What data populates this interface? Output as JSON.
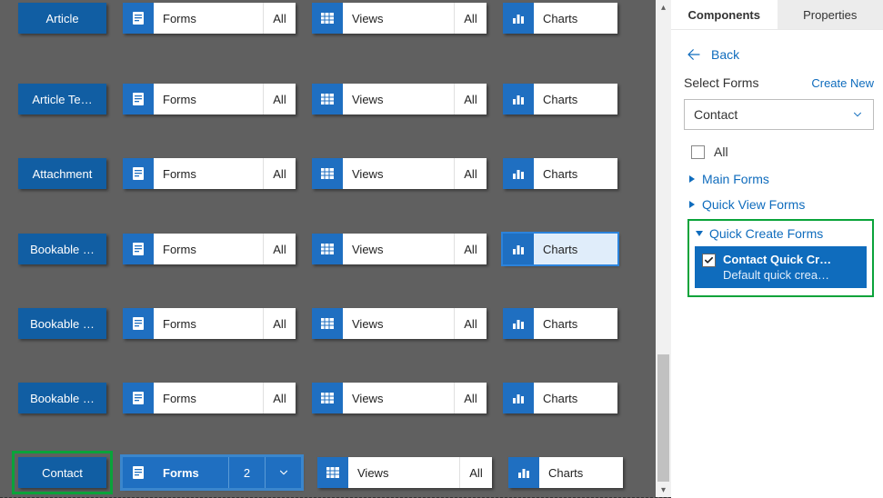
{
  "canvas": {
    "rows": [
      {
        "entity": "Article",
        "selected": false,
        "forms": {
          "label": "Forms",
          "tag": "All",
          "selected": false
        },
        "views": {
          "label": "Views",
          "tag": "All"
        },
        "charts": {
          "label": "Charts",
          "highlight": false
        }
      },
      {
        "entity": "Article Te…",
        "selected": false,
        "forms": {
          "label": "Forms",
          "tag": "All",
          "selected": false
        },
        "views": {
          "label": "Views",
          "tag": "All"
        },
        "charts": {
          "label": "Charts",
          "highlight": false
        }
      },
      {
        "entity": "Attachment",
        "selected": false,
        "forms": {
          "label": "Forms",
          "tag": "All",
          "selected": false
        },
        "views": {
          "label": "Views",
          "tag": "All"
        },
        "charts": {
          "label": "Charts",
          "highlight": false
        }
      },
      {
        "entity": "Bookable …",
        "selected": false,
        "forms": {
          "label": "Forms",
          "tag": "All",
          "selected": false
        },
        "views": {
          "label": "Views",
          "tag": "All"
        },
        "charts": {
          "label": "Charts",
          "highlight": true
        }
      },
      {
        "entity": "Bookable …",
        "selected": false,
        "forms": {
          "label": "Forms",
          "tag": "All",
          "selected": false
        },
        "views": {
          "label": "Views",
          "tag": "All"
        },
        "charts": {
          "label": "Charts",
          "highlight": false
        }
      },
      {
        "entity": "Bookable …",
        "selected": false,
        "forms": {
          "label": "Forms",
          "tag": "All",
          "selected": false
        },
        "views": {
          "label": "Views",
          "tag": "All"
        },
        "charts": {
          "label": "Charts",
          "highlight": false
        }
      },
      {
        "entity": "Contact",
        "selected": true,
        "forms": {
          "label": "Forms",
          "count": "2",
          "selected": true
        },
        "views": {
          "label": "Views",
          "tag": "All"
        },
        "charts": {
          "label": "Charts",
          "highlight": false
        }
      }
    ]
  },
  "panel": {
    "tabs": {
      "components": "Components",
      "properties": "Properties"
    },
    "back_label": "Back",
    "select_forms_label": "Select Forms",
    "create_new_label": "Create New",
    "dropdown_value": "Contact",
    "all_label": "All",
    "groups": {
      "main": "Main Forms",
      "quickview": "Quick View Forms",
      "quickcreate": "Quick Create Forms"
    },
    "quickcreate_item": {
      "title": "Contact Quick Cr…",
      "subtitle": "Default quick crea…",
      "checked": true
    }
  },
  "icons": {
    "forms": "form-icon",
    "views": "table-icon",
    "charts": "bar-chart-icon"
  }
}
